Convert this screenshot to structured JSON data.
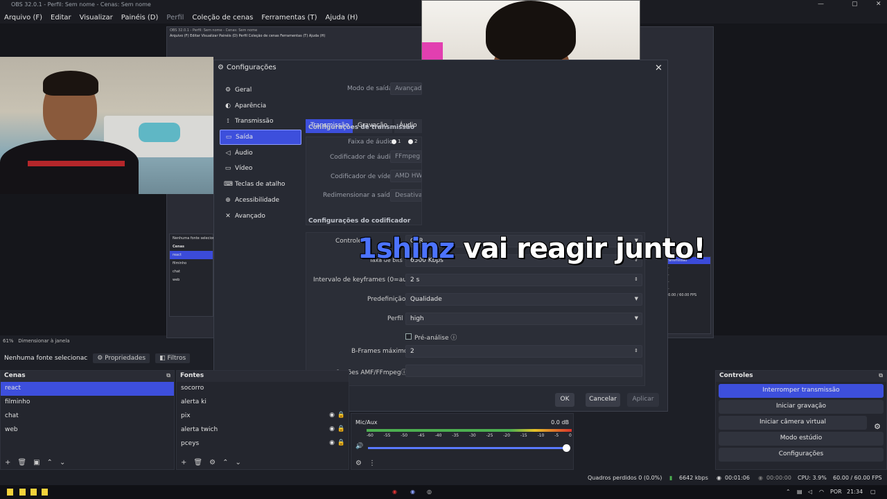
{
  "window": {
    "title": "OBS 32.0.1 - Perfil: Sem nome - Cenas: Sem nome",
    "menu": [
      "Arquivo (F)",
      "Editar",
      "Visualizar",
      "Painéis (D)",
      "Perfil",
      "Coleção de cenas",
      "Ferramentas (T)",
      "Ajuda (H)"
    ]
  },
  "mini_obs": {
    "title": "OBS 32.0.1 - Perfil: Sem nome - Cenas: Sem nome",
    "menu": "Arquivo (F)   Editar   Visualizar   Painéis (D)   Perfil   Coleção de cenas   Ferramentas (T)   Ajuda (H)",
    "scenes_header": "Cenas",
    "no_source": "Nenhuma fonte selecionad",
    "scenes": [
      "react",
      "filminho",
      "chat",
      "web"
    ],
    "right_list": [
      "transmissão",
      "...",
      "...",
      "...",
      "..."
    ],
    "fps": "60.00 / 60.00 FPS"
  },
  "dialog": {
    "title": "Configurações",
    "close": "✕",
    "nav": [
      {
        "label": "Geral",
        "icon": "gear-icon",
        "glyph": "⚙"
      },
      {
        "label": "Aparência",
        "icon": "palette-icon",
        "glyph": "◐"
      },
      {
        "label": "Transmissão",
        "icon": "antenna-icon",
        "glyph": "⟟"
      },
      {
        "label": "Saída",
        "icon": "output-icon",
        "glyph": "▭"
      },
      {
        "label": "Áudio",
        "icon": "speaker-icon",
        "glyph": "◁"
      },
      {
        "label": "Vídeo",
        "icon": "monitor-icon",
        "glyph": "▭"
      },
      {
        "label": "Teclas de atalho",
        "icon": "keyboard-icon",
        "glyph": "⌨"
      },
      {
        "label": "Acessibilidade",
        "icon": "accessibility-icon",
        "glyph": "⊕"
      },
      {
        "label": "Avançado",
        "icon": "tools-icon",
        "glyph": "✕"
      }
    ],
    "output_mode_label": "Modo de saída",
    "output_mode_value": "Avançado",
    "tabs": [
      "Transmissão",
      "Gravação",
      "Áudio"
    ],
    "stream_section": "Configurações de transmissão",
    "audio_track_label": "Faixa de áudio",
    "audio_track_1": "1",
    "audio_track_2": "2",
    "audio_encoder_label": "Codificador de áudio",
    "audio_encoder_value": "FFmpeg A",
    "video_encoder_label": "Codificador de vídeo",
    "video_encoder_value": "AMD HW",
    "rescale_label": "Redimensionar a saída",
    "rescale_value": "Desativad",
    "encoder_section": "Configurações do codificador",
    "rate_control_label": "Controle",
    "rate_control_value": "CBR",
    "bitrate_label": "Taxa de bits",
    "bitrate_value": "6500 Kbps",
    "keyframe_label": "Intervalo de keyframes (0=auto)",
    "keyframe_value": "2 s",
    "preset_label": "Predefinição",
    "preset_value": "Qualidade",
    "profile_label": "Perfil",
    "profile_value": "high",
    "lookahead_label": "Pré-análise",
    "bframes_label": "B-Frames máximo",
    "bframes_value": "2",
    "amf_label": "Opções AMF/FFmpeg",
    "amf_value": "",
    "ok": "OK",
    "cancel": "Cancelar",
    "apply": "Aplicar"
  },
  "overlay": {
    "highlight": "1shinz",
    "rest": " vai reagir junto!"
  },
  "preview_strip": {
    "zoom": "61%",
    "fit": "Dimensionar à janela"
  },
  "source_bar": {
    "none_selected": "Nenhuma fonte selecionac",
    "properties": "Propriedades",
    "filters": "Filtros"
  },
  "scenes_dock": {
    "title": "Cenas",
    "items": [
      "react",
      "filminho",
      "chat",
      "web"
    ],
    "selected": 0
  },
  "sources_dock": {
    "title": "Fontes",
    "items": [
      "socorro",
      "alerta ki",
      "pix",
      "alerta twich",
      "pceys"
    ]
  },
  "mixer": {
    "channel": "Mic/Aux",
    "level": "0.0 dB",
    "ticks": [
      "-60",
      "-55",
      "-50",
      "-45",
      "-40",
      "-35",
      "-30",
      "-25",
      "-20",
      "-15",
      "-10",
      "-5",
      "0"
    ]
  },
  "controls_dock": {
    "title": "Controles",
    "buttons": [
      "Interromper transmissão",
      "Iniciar gravação",
      "Iniciar câmera virtual",
      "Modo estúdio",
      "Configurações"
    ]
  },
  "statusbar": {
    "dropped": "Quadros perdidos 0 (0.0%)",
    "bitrate": "6642 kbps",
    "stream_time": "00:01:06",
    "rec_time": "00:00:00",
    "cpu": "CPU: 3.9%",
    "fps": "60.00 / 60.00 FPS"
  },
  "taskbar": {
    "lang": "POR",
    "clock": "21:34"
  },
  "colors": {
    "accent": "#3d4fdc",
    "dialog_bg": "#272a33",
    "overlay_highlight": "#4c73ff"
  }
}
